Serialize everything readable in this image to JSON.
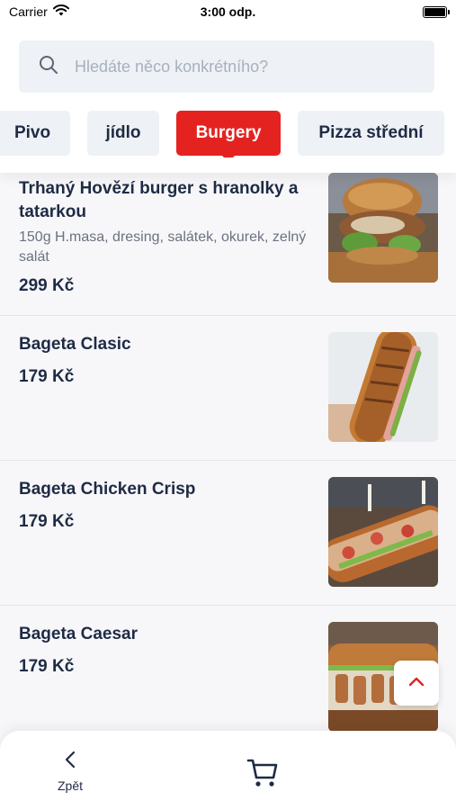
{
  "status_bar": {
    "carrier": "Carrier",
    "time": "3:00 odp."
  },
  "search": {
    "placeholder": "Hledáte něco konkrétního?"
  },
  "categories": [
    {
      "label": "Pivo",
      "active": false
    },
    {
      "label": "jídlo",
      "active": false
    },
    {
      "label": "Burgery",
      "active": true
    },
    {
      "label": "Pizza střední",
      "active": false
    }
  ],
  "products": [
    {
      "title": "Trhaný Hovězí burger s hranolky a tatarkou",
      "description": "150g H.masa, dresing, salátek, okurek, zelný salát",
      "price": "299 Kč"
    },
    {
      "title": "Bageta Clasic",
      "description": "",
      "price": "179 Kč"
    },
    {
      "title": "Bageta Chicken Crisp",
      "description": "",
      "price": "179 Kč"
    },
    {
      "title": "Bageta Caesar",
      "description": "",
      "price": "179 Kč"
    }
  ],
  "bottom_bar": {
    "back_label": "Zpět"
  },
  "colors": {
    "accent": "#e42320",
    "text": "#1f2b45",
    "muted": "#6b7280",
    "background": "#f7f7f9"
  }
}
